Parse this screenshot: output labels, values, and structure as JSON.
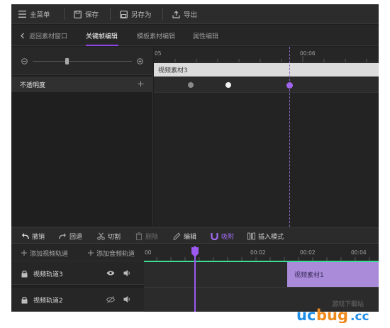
{
  "menubar": {
    "items": [
      {
        "label": "主菜单",
        "icon": "menu-icon"
      },
      {
        "label": "保存",
        "icon": "save-icon"
      },
      {
        "label": "另存为",
        "icon": "save-as-icon"
      },
      {
        "label": "导出",
        "icon": "export-icon"
      }
    ]
  },
  "tabs": {
    "back_label": "返回素材窗口",
    "items": [
      {
        "label": "关键帧编辑",
        "active": true
      },
      {
        "label": "模板素材编辑",
        "active": false
      },
      {
        "label": "属性编辑",
        "active": false
      }
    ]
  },
  "keyframe": {
    "property_label": "不透明度",
    "ruler_ticks": [
      "05",
      "00:06"
    ],
    "clip_name": "视频素材3",
    "points": [
      {
        "state": "inactive"
      },
      {
        "state": "normal"
      },
      {
        "state": "selected"
      }
    ]
  },
  "toolbar": {
    "items": [
      {
        "label": "撤销",
        "icon": "undo-icon",
        "state": "normal"
      },
      {
        "label": "回退",
        "icon": "redo-icon",
        "state": "normal"
      },
      {
        "label": "切割",
        "icon": "scissors-icon",
        "state": "normal"
      },
      {
        "label": "删除",
        "icon": "trash-icon",
        "state": "disabled"
      },
      {
        "label": "编辑",
        "icon": "pencil-icon",
        "state": "normal"
      },
      {
        "label": "吸附",
        "icon": "magnet-icon",
        "state": "active"
      },
      {
        "label": "插入模式",
        "icon": "insert-mode-icon",
        "state": "normal"
      }
    ]
  },
  "timeline": {
    "add_video_label": "添加视频轨道",
    "add_audio_label": "添加音频轨道",
    "ruler_ticks": [
      "00",
      "00:02",
      "00:02",
      "00:04"
    ],
    "tracks": [
      {
        "name": "视频轨道3",
        "visible": true
      },
      {
        "name": "视频轨道2",
        "visible": false
      }
    ],
    "clip_name": "视频素材1"
  },
  "colors": {
    "accent": "#9b59f0",
    "timeline_line": "#3ddc97",
    "clip": "#a98bd9"
  },
  "watermark": {
    "text": "ucbug.cc",
    "subtext": "游戏下载站"
  }
}
